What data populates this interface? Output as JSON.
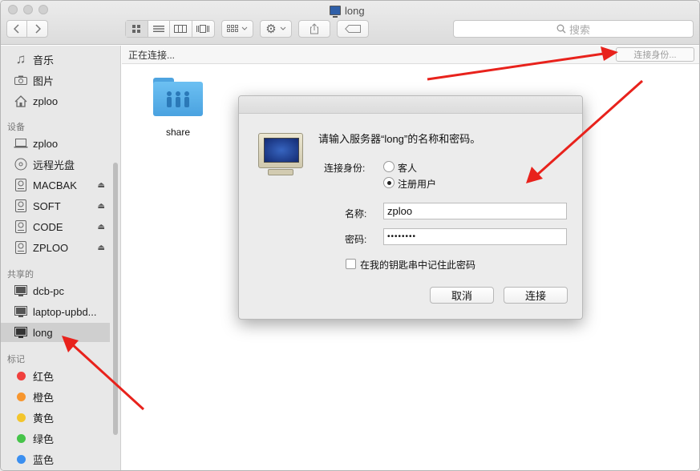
{
  "window": {
    "title": "long"
  },
  "toolbar": {
    "back_icon": "chevron-left-icon",
    "forward_icon": "chevron-right-icon",
    "view_icons": [
      "grid-view-icon",
      "list-view-icon",
      "column-view-icon",
      "coverflow-view-icon"
    ],
    "arrange_icon": "arrange-icon",
    "action_icon": "gear-icon",
    "share_icon": "share-icon",
    "tag_icon": "tag-icon",
    "search_placeholder": "搜索"
  },
  "sidebar": {
    "favorites": [
      {
        "label": "音乐",
        "icon": "music-note-icon"
      },
      {
        "label": "图片",
        "icon": "camera-icon"
      },
      {
        "label": "zploo",
        "icon": "home-icon"
      }
    ],
    "devices_header": "设备",
    "devices": [
      {
        "label": "zploo",
        "icon": "laptop-icon",
        "eject": false
      },
      {
        "label": "远程光盘",
        "icon": "disc-icon",
        "eject": false
      },
      {
        "label": "MACBAK",
        "icon": "drive-icon",
        "eject": true
      },
      {
        "label": "SOFT",
        "icon": "drive-icon",
        "eject": true
      },
      {
        "label": "CODE",
        "icon": "drive-icon",
        "eject": true
      },
      {
        "label": "ZPLOO",
        "icon": "drive-icon",
        "eject": true
      }
    ],
    "shared_header": "共享的",
    "shared": [
      {
        "label": "dcb-pc",
        "icon": "monitor-icon"
      },
      {
        "label": "laptop-upbd...",
        "icon": "monitor-icon"
      },
      {
        "label": "long",
        "icon": "monitor-icon",
        "selected": true
      }
    ],
    "tags_header": "标记",
    "tags": [
      {
        "label": "红色",
        "color": "#f0403d"
      },
      {
        "label": "橙色",
        "color": "#f7962e"
      },
      {
        "label": "黄色",
        "color": "#f3c52c"
      },
      {
        "label": "绿色",
        "color": "#46c44a"
      },
      {
        "label": "蓝色",
        "color": "#3b8ff0"
      }
    ]
  },
  "content": {
    "status": "正在连接...",
    "connect_as_button": "连接身份...",
    "folder": {
      "label": "share",
      "icon": "shared-folder-icon"
    }
  },
  "dialog": {
    "icon": "server-monitor-icon",
    "prompt": "请输入服务器“long”的名称和密码。",
    "connect_as_label": "连接身份:",
    "options": [
      {
        "label": "客人",
        "selected": false
      },
      {
        "label": "注册用户",
        "selected": true
      }
    ],
    "name_label": "名称:",
    "name_value": "zploo",
    "password_label": "密码:",
    "password_value": "••••••••",
    "remember_label": "在我的钥匙串中记住此密码",
    "remember_checked": false,
    "cancel_button": "取消",
    "connect_button": "连接"
  },
  "colors": {
    "arrow": "#e8221c",
    "selection": "#cfcfcf",
    "folder": "#5cb3ec"
  }
}
